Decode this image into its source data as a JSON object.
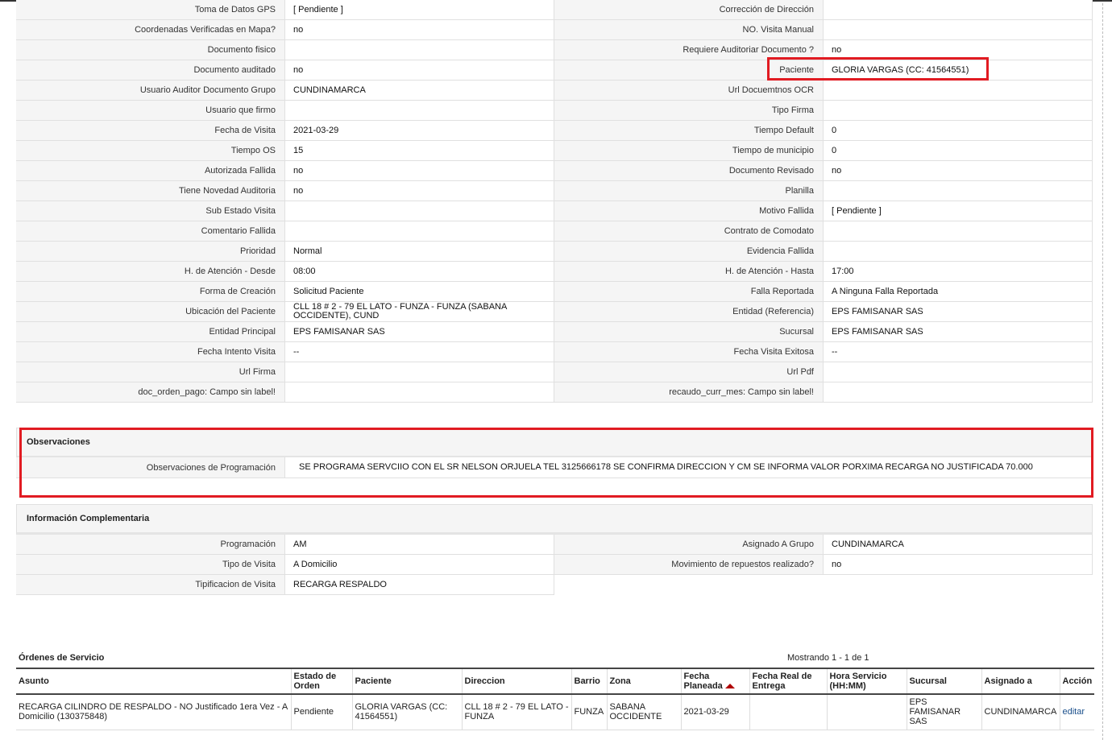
{
  "info_rows": [
    {
      "left_label": "Toma de Datos GPS",
      "left_value": "[ Pendiente ]",
      "right_label": "Corrección de Dirección",
      "right_value": ""
    },
    {
      "left_label": "Coordenadas Verificadas en Mapa?",
      "left_value": "no",
      "right_label": "NO. Visita Manual",
      "right_value": ""
    },
    {
      "left_label": "Documento fisico",
      "left_value": "",
      "right_label": "Requiere Auditoriar Documento ?",
      "right_value": "no"
    },
    {
      "left_label": "Documento auditado",
      "left_value": "no",
      "right_label": "Paciente",
      "right_value": "GLORIA VARGAS (CC: 41564551)"
    },
    {
      "left_label": "Usuario Auditor Documento Grupo",
      "left_value": "CUNDINAMARCA",
      "right_label": "Url Docuemtnos OCR",
      "right_value": ""
    },
    {
      "left_label": "Usuario que firmo",
      "left_value": "",
      "right_label": "Tipo Firma",
      "right_value": ""
    },
    {
      "left_label": "Fecha de Visita",
      "left_value": "2021-03-29",
      "right_label": "Tiempo Default",
      "right_value": "0"
    },
    {
      "left_label": "Tiempo OS",
      "left_value": "15",
      "right_label": "Tiempo de municipio",
      "right_value": "0"
    },
    {
      "left_label": "Autorizada Fallida",
      "left_value": "no",
      "right_label": "Documento Revisado",
      "right_value": "no"
    },
    {
      "left_label": "Tiene Novedad Auditoria",
      "left_value": "no",
      "right_label": "Planilla",
      "right_value": ""
    },
    {
      "left_label": "Sub Estado Visita",
      "left_value": "",
      "right_label": "Motivo Fallida",
      "right_value": "[ Pendiente ]"
    },
    {
      "left_label": "Comentario Fallida",
      "left_value": "",
      "right_label": "Contrato de Comodato",
      "right_value": ""
    },
    {
      "left_label": "Prioridad",
      "left_value": "Normal",
      "right_label": "Evidencia Fallida",
      "right_value": ""
    },
    {
      "left_label": "H. de Atención - Desde",
      "left_value": "08:00",
      "right_label": "H. de Atención - Hasta",
      "right_value": "17:00"
    },
    {
      "left_label": "Forma de Creación",
      "left_value": "Solicitud Paciente",
      "right_label": "Falla Reportada",
      "right_value": "A Ninguna Falla Reportada"
    },
    {
      "left_label": "Ubicación del Paciente",
      "left_value": "CLL 18 # 2 - 79 EL LATO - FUNZA - FUNZA (SABANA OCCIDENTE), CUND",
      "right_label": "Entidad (Referencia)",
      "right_value": "EPS FAMISANAR SAS"
    },
    {
      "left_label": "Entidad Principal",
      "left_value": "EPS FAMISANAR SAS",
      "right_label": "Sucursal",
      "right_value": "EPS FAMISANAR SAS"
    },
    {
      "left_label": "Fecha Intento Visita",
      "left_value": "--",
      "right_label": "Fecha Visita Exitosa",
      "right_value": "--"
    },
    {
      "left_label": "Url Firma",
      "left_value": "",
      "right_label": "Url Pdf",
      "right_value": ""
    },
    {
      "left_label": "doc_orden_pago: Campo sin label!",
      "left_value": "",
      "right_label": "recaudo_curr_mes: Campo sin label!",
      "right_value": ""
    }
  ],
  "observaciones": {
    "title": "Observaciones",
    "label": "Observaciones de Programación",
    "value": "SE PROGRAMA SERVCIIO CON EL SR NELSON ORJUELA TEL 3125666178 SE CONFIRMA DIRECCION Y CM SE INFORMA VALOR PORXIMA RECARGA NO JUSTIFICADA 70.000"
  },
  "info_complementaria": {
    "title": "Información Complementaria",
    "rows": [
      {
        "left_label": "Programación",
        "left_value": "AM",
        "right_label": "Asignado A Grupo",
        "right_value": "CUNDINAMARCA"
      },
      {
        "left_label": "Tipo de Visita",
        "left_value": "A Domicilio",
        "right_label": "Movimiento de repuestos realizado?",
        "right_value": "no"
      },
      {
        "left_label": "Tipificacion de Visita",
        "left_value": "RECARGA RESPALDO"
      }
    ]
  },
  "ordenes": {
    "title": "Órdenes de Servicio",
    "count_text": "Mostrando 1 - 1 de 1",
    "columns": [
      "Asunto",
      "Estado de Orden",
      "Paciente",
      "Direccion",
      "Barrio",
      "Zona",
      "Fecha Planeada",
      "Fecha Real de Entrega",
      "Hora Servicio (HH:MM)",
      "Sucursal",
      "Asignado a",
      "Acción"
    ],
    "rows": [
      {
        "asunto": "RECARGA CILINDRO DE RESPALDO - NO Justificado 1era Vez - A Domicilio (130375848)",
        "estado": "Pendiente",
        "paciente": "GLORIA VARGAS (CC: 41564551)",
        "direccion": "CLL 18 # 2 - 79 EL LATO - FUNZA",
        "barrio": "FUNZA",
        "zona": "SABANA OCCIDENTE",
        "fecha_planeada": "2021-03-29",
        "fecha_real": "",
        "hora": "",
        "sucursal": "EPS FAMISANAR SAS",
        "asignado": "CUNDINAMARCA",
        "accion": "editar"
      }
    ]
  },
  "colors": {
    "highlight": "#e11b22",
    "label_bg": "#f5f5f5",
    "sort_arrow": "#b00000"
  }
}
